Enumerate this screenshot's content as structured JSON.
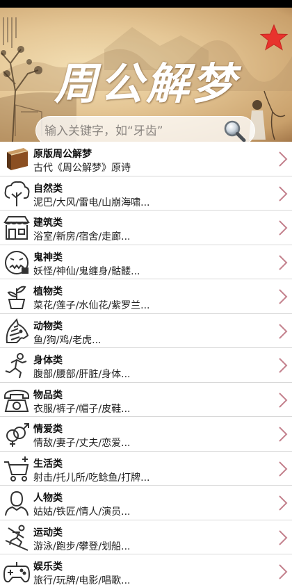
{
  "header": {
    "app_title": "周公解梦",
    "search_placeholder": "输入关键字，如“牙齿”"
  },
  "categories": [
    {
      "title": "原版周公解梦",
      "subtitle": "古代《周公解梦》原诗",
      "icon": "book-icon"
    },
    {
      "title": "自然类",
      "subtitle": "泥巴/大风/雷电/山崩海啸...",
      "icon": "tree-icon"
    },
    {
      "title": "建筑类",
      "subtitle": "浴室/新房/宿舍/走廊...",
      "icon": "building-icon"
    },
    {
      "title": "鬼神类",
      "subtitle": "妖怪/神仙/鬼缠身/骷髅...",
      "icon": "ghost-face-icon"
    },
    {
      "title": "植物类",
      "subtitle": "菜花/莲子/水仙花/紫罗兰...",
      "icon": "potted-plant-icon"
    },
    {
      "title": "动物类",
      "subtitle": "鱼/狗/鸡/老虎...",
      "icon": "zebra-head-icon"
    },
    {
      "title": "身体类",
      "subtitle": "腹部/腰部/肝脏/身体...",
      "icon": "running-person-icon"
    },
    {
      "title": "物品类",
      "subtitle": "衣服/裤子/帽子/皮鞋...",
      "icon": "telephone-icon"
    },
    {
      "title": "情爱类",
      "subtitle": "情敌/妻子/丈夫/恋爱...",
      "icon": "gender-symbols-icon"
    },
    {
      "title": "生活类",
      "subtitle": "射击/托儿所/吃鲶鱼/打牌...",
      "icon": "shopping-cart-icon"
    },
    {
      "title": "人物类",
      "subtitle": "姑姑/铁匠/情人/演员...",
      "icon": "person-icon"
    },
    {
      "title": "运动类",
      "subtitle": "游泳/跑步/攀登/划船...",
      "icon": "skier-icon"
    },
    {
      "title": "娱乐类",
      "subtitle": "旅行/玩牌/电影/唱歌...",
      "icon": "gamepad-icon"
    }
  ],
  "colors": {
    "accent_star": "#e8332d",
    "chevron": "#c4828e",
    "divider": "#d8d8d8"
  }
}
